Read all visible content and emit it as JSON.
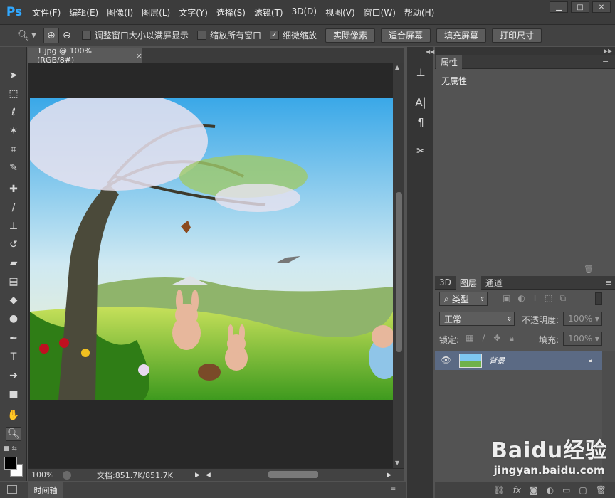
{
  "app": {
    "logo": "Ps"
  },
  "menu": [
    "文件(F)",
    "编辑(E)",
    "图像(I)",
    "图层(L)",
    "文字(Y)",
    "选择(S)",
    "滤镜(T)",
    "3D(D)",
    "视图(V)",
    "窗口(W)",
    "帮助(H)"
  ],
  "window_controls": {
    "minimize_icon": "minimize-icon",
    "restore_icon": "restore-icon",
    "close_icon": "close-icon"
  },
  "options": {
    "checkboxes": [
      {
        "label": "调整窗口大小以满屏显示",
        "checked": false
      },
      {
        "label": "缩放所有窗口",
        "checked": false
      },
      {
        "label": "细微缩放",
        "checked": true
      }
    ],
    "buttons": [
      "实际像素",
      "适合屏幕",
      "填充屏幕",
      "打印尺寸"
    ]
  },
  "document": {
    "tab_title": "1.jpg @ 100%(RGB/8#)",
    "tab_close": "×",
    "zoom": "100%",
    "doc_info": "文档:851.7K/851.7K"
  },
  "timeline": {
    "label": "时间轴"
  },
  "properties": {
    "tab": "属性",
    "empty_text": "无属性"
  },
  "layers": {
    "tabs": [
      "3D",
      "图层",
      "通道"
    ],
    "filter_label": "类型",
    "blend_mode": "正常",
    "opacity_label": "不透明度:",
    "opacity_value": "100%",
    "lock_label": "锁定:",
    "fill_label": "填充:",
    "fill_value": "100%",
    "items": [
      {
        "name": "背景",
        "locked": true,
        "visible": true
      }
    ]
  },
  "watermark": {
    "text": "Baidu经验",
    "url": "jingyan.baidu.com"
  },
  "colors": {
    "accent": "#31a8ff",
    "selected_layer": "#5b6a84",
    "panel": "#535353",
    "chrome": "#424242"
  }
}
